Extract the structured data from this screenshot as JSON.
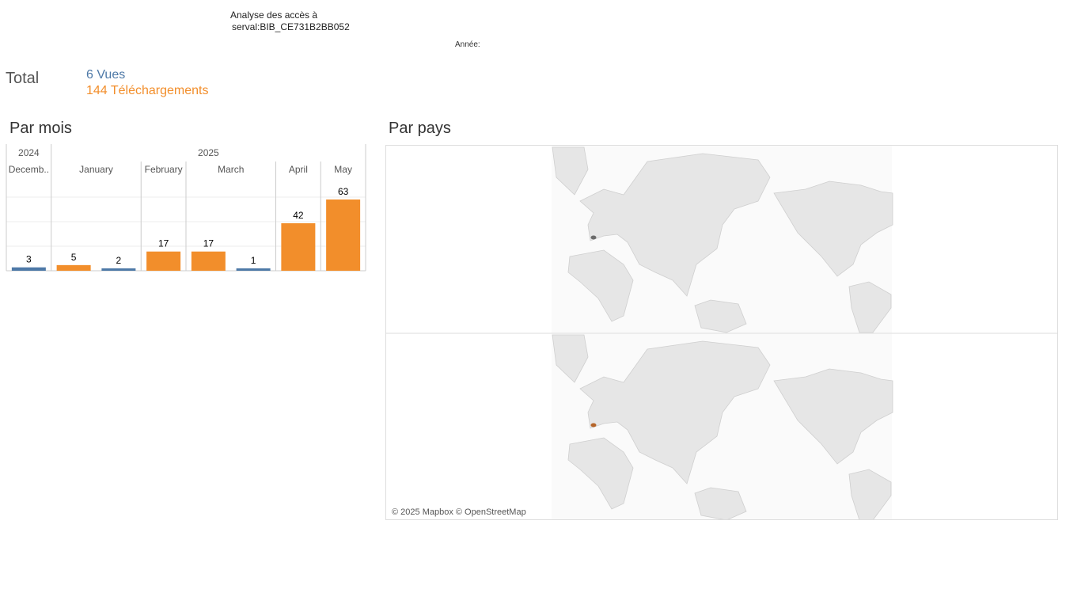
{
  "header": {
    "title_line1": "Analyse des accès à",
    "title_line2": "serval:BIB_CE731B2BB052",
    "year_label": "Année:"
  },
  "totals": {
    "label": "Total",
    "views": "6 Vues",
    "downloads": "144 Téléchargements"
  },
  "sections": {
    "by_month": "Par mois",
    "by_country": "Par pays"
  },
  "colors": {
    "views": "#4e79a7",
    "downloads": "#f28e2b"
  },
  "chart_data": {
    "type": "bar",
    "years": [
      {
        "label": "2024",
        "months": 1
      },
      {
        "label": "2025",
        "months": 5
      }
    ],
    "months": [
      {
        "label": "Decemb..",
        "bars": [
          {
            "series": "Vues",
            "value": 3
          }
        ]
      },
      {
        "label": "January",
        "bars": [
          {
            "series": "Téléchargements",
            "value": 5
          },
          {
            "series": "Vues",
            "value": 2
          }
        ]
      },
      {
        "label": "February",
        "bars": [
          {
            "series": "Téléchargements",
            "value": 17
          }
        ]
      },
      {
        "label": "March",
        "bars": [
          {
            "series": "Téléchargements",
            "value": 17
          },
          {
            "series": "Vues",
            "value": 1
          }
        ]
      },
      {
        "label": "April",
        "bars": [
          {
            "series": "Téléchargements",
            "value": 42
          }
        ]
      },
      {
        "label": "May",
        "bars": [
          {
            "series": "Téléchargements",
            "value": 63
          }
        ]
      }
    ],
    "ylim": [
      0,
      70
    ],
    "grid": true
  },
  "map": {
    "attribution": "© 2025 Mapbox © OpenStreetMap",
    "panels": [
      {
        "series": "Vues",
        "highlight": "Switzerland"
      },
      {
        "series": "Téléchargements",
        "highlight": "Switzerland"
      }
    ]
  }
}
